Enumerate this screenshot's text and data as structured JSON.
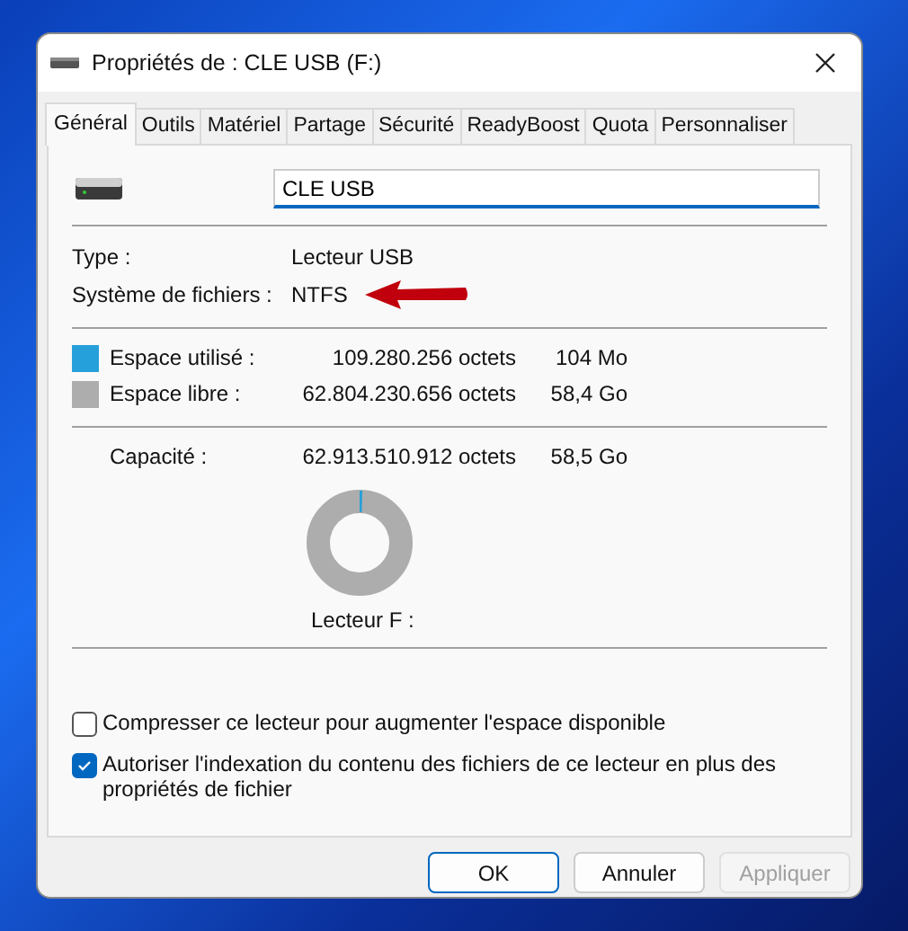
{
  "window": {
    "title": "Propriétés de : CLE USB (F:)"
  },
  "tabs": [
    {
      "label": "Général",
      "selected": true
    },
    {
      "label": "Outils",
      "selected": false
    },
    {
      "label": "Matériel",
      "selected": false
    },
    {
      "label": "Partage",
      "selected": false
    },
    {
      "label": "Sécurité",
      "selected": false
    },
    {
      "label": "ReadyBoost",
      "selected": false
    },
    {
      "label": "Quota",
      "selected": false
    },
    {
      "label": "Personnaliser",
      "selected": false
    }
  ],
  "name_field": {
    "value": "CLE USB"
  },
  "info": [
    {
      "label": "Type :",
      "value": "Lecteur USB",
      "annotated": false
    },
    {
      "label": "Système de fichiers :",
      "value": "NTFS",
      "annotated": true
    }
  ],
  "space": [
    {
      "label": "Espace utilisé :",
      "bytes": "109.280.256 octets",
      "size": "104 Mo",
      "color": "#26a0da"
    },
    {
      "label": "Espace libre :",
      "bytes": "62.804.230.656 octets",
      "size": "58,4 Go",
      "color": "#adadad"
    }
  ],
  "capacity": {
    "label": "Capacité :",
    "bytes": "62.913.510.912 octets",
    "size": "58,5 Go"
  },
  "drive_label": "Lecteur F :",
  "options": [
    {
      "label": "Compresser ce lecteur pour augmenter l'espace disponible",
      "checked": false
    },
    {
      "label": "Autoriser l'indexation du contenu des fichiers de ce lecteur en plus des propriétés de fichier",
      "checked": true
    }
  ],
  "buttons": [
    {
      "label": "OK",
      "default": true,
      "disabled": false
    },
    {
      "label": "Annuler",
      "default": false,
      "disabled": false
    },
    {
      "label": "Appliquer",
      "default": false,
      "disabled": true
    }
  ]
}
